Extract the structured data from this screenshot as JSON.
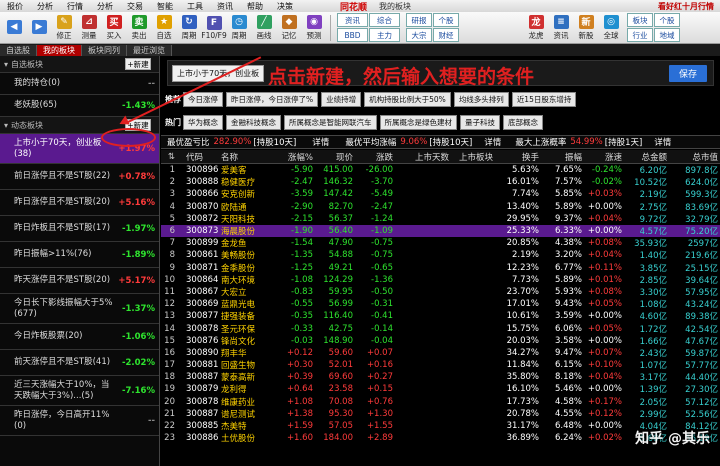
{
  "menu": {
    "items": [
      "报价",
      "分析",
      "行情",
      "分析",
      "交易",
      "智能",
      "工具",
      "资讯",
      "帮助",
      "决策"
    ],
    "brand": "同花顺",
    "board": "我的板块",
    "promo": "看好红十月行情"
  },
  "toolbar": {
    "buttons": [
      {
        "label": "",
        "icon": "back-icon",
        "color": "#3a7bd5"
      },
      {
        "label": "",
        "icon": "forward-icon",
        "color": "#3a7bd5"
      },
      {
        "label": "修正",
        "icon": "edit-icon",
        "color": "#d9a21b"
      },
      {
        "label": "测量",
        "icon": "measure-icon",
        "color": "#c03030"
      },
      {
        "label": "买入",
        "icon": "buy-icon",
        "color": "#d02020"
      },
      {
        "label": "卖出",
        "icon": "sell-icon",
        "color": "#1f9a2a"
      },
      {
        "label": "自选",
        "icon": "star-icon",
        "color": "#e0a000"
      },
      {
        "label": "周期",
        "icon": "cycle-icon",
        "color": "#3060c0"
      },
      {
        "label": "F10/F9",
        "icon": "f10-icon",
        "color": "#5050b0"
      },
      {
        "label": "周期",
        "icon": "period-icon",
        "color": "#2a8ad0"
      },
      {
        "label": "画线",
        "icon": "draw-line-icon",
        "color": "#30a060"
      },
      {
        "label": "记忆",
        "icon": "memory-icon",
        "color": "#c07020"
      },
      {
        "label": "预测",
        "icon": "forecast-icon",
        "color": "#8040c0"
      }
    ],
    "tabs1": [
      "资讯",
      "综合",
      "BBD",
      "主力"
    ],
    "tabs2": [
      "研报",
      "个股",
      "大宗",
      "财经"
    ],
    "right_buttons": [
      {
        "label": "龙虎",
        "icon": "dragon-tiger-icon",
        "color": "#d03030"
      },
      {
        "label": "资讯",
        "icon": "news-icon",
        "color": "#3070c0"
      },
      {
        "label": "新股",
        "icon": "new-stock-icon",
        "color": "#d08020"
      },
      {
        "label": "全球",
        "icon": "globe-icon",
        "color": "#2090d0"
      }
    ],
    "right_tabs": [
      "板块",
      "个股",
      "行业",
      "地域"
    ]
  },
  "tabs": [
    "自选股",
    "我的板块",
    "板块同列",
    "最近浏览"
  ],
  "active_tab_index": 1,
  "sidebar": {
    "section1": {
      "title": "自选板块",
      "new_label": "+新建"
    },
    "section1_items": [
      {
        "name": "我的持仓(0)",
        "pct": "",
        "dir": ""
      },
      {
        "name": "老妖股(65)",
        "pct": "-1.43%",
        "dir": "dn"
      }
    ],
    "section2": {
      "title": "动态板块",
      "new_label": "+新建"
    },
    "section2_items": [
      {
        "name": "上市小于70天，创业板\n(38)",
        "pct": "+1.97%",
        "dir": "up",
        "selected": true
      },
      {
        "name": "前日涨停且不是ST股(22)",
        "pct": "+0.78%",
        "dir": "up"
      },
      {
        "name": "昨日涨停且不是ST股(20)",
        "pct": "+5.16%",
        "dir": "up"
      },
      {
        "name": "昨日炸板且不是ST股(17)",
        "pct": "-1.97%",
        "dir": "dn"
      },
      {
        "name": "昨日振幅>11%(76)",
        "pct": "-1.89%",
        "dir": "dn"
      },
      {
        "name": "昨天涨停且不是ST股(20)",
        "pct": "+5.17%",
        "dir": "up"
      },
      {
        "name": "今日长下影线振幅大于5%\n(677)",
        "pct": "-1.37%",
        "dir": "dn"
      },
      {
        "name": "今日炸板股票(20)",
        "pct": "-1.06%",
        "dir": "dn"
      },
      {
        "name": "前天涨停且不是ST股(41)",
        "pct": "-2.02%",
        "dir": "dn"
      },
      {
        "name": "近三天涨幅大于10%，当\n天跌幅大于3%)...(5)",
        "pct": "-7.16%",
        "dir": "dn"
      },
      {
        "name": "昨日涨停，今日高开11%\n(0)",
        "pct": "",
        "dir": ""
      }
    ]
  },
  "condition": {
    "current": "上市小于70天，创业板",
    "annotation": "点击新建，然后输入想要的条件",
    "save_label": "保存"
  },
  "recommend": {
    "label": "推荐",
    "chips": [
      "今日涨停",
      "昨日涨停，今日涨停了%",
      "业绩持增",
      "机构持股比例大于50%",
      "均线多头排列",
      "近15日股东增持"
    ]
  },
  "hot": {
    "label": "热门",
    "chips": [
      "华为概念",
      "金融科技概念",
      "所属概念是智能网联汽车",
      "所属概念是绿色建材",
      "量子科技",
      "底部概念"
    ]
  },
  "stats": {
    "max_gain_label": "最优盈亏比",
    "max_gain_value": "282.90%",
    "max_gain_note": "[持股10天]",
    "detail1": "详情",
    "avg_label": "最优平均涨幅",
    "avg_value": "9.06%",
    "avg_note": "[持股10天]",
    "detail2": "详情",
    "max_up_label": "最大上涨概率",
    "max_up_value": "54.99%",
    "max_up_note": "[持股1天]",
    "detail3": "详情"
  },
  "table": {
    "headers": [
      "",
      "代码",
      "名称",
      "涨幅%",
      "现价",
      "涨跌",
      "上市天数",
      "上市板块",
      "换手",
      "振幅",
      "涨速",
      "总金额",
      "总市值"
    ],
    "rows": [
      [
        "1",
        "300896",
        "爱美客",
        "-5.90",
        "415.00",
        "-26.00",
        "",
        "",
        "5.63%",
        "7.65%",
        "-0.24%",
        "6.20亿",
        "897.8亿"
      ],
      [
        "2",
        "300888",
        "稳健医疗",
        "-2.47",
        "146.32",
        "-3.70",
        "",
        "",
        "16.01%",
        "7.57%",
        "-0.02%",
        "10.52亿",
        "624.0亿"
      ],
      [
        "3",
        "300866",
        "安克创新",
        "-3.59",
        "147.42",
        "-5.49",
        "",
        "",
        "7.74%",
        "5.85%",
        "+0.03%",
        "2.19亿",
        "599.3亿"
      ],
      [
        "4",
        "300870",
        "欧陆通",
        "-2.90",
        "82.70",
        "-2.47",
        "",
        "",
        "13.40%",
        "5.89%",
        "+0.00%",
        "2.75亿",
        "83.69亿"
      ],
      [
        "5",
        "300872",
        "天阳科技",
        "-2.15",
        "56.37",
        "-1.24",
        "",
        "",
        "29.95%",
        "9.37%",
        "+0.04%",
        "9.72亿",
        "32.79亿"
      ],
      [
        "6",
        "300873",
        "海晨股份",
        "-1.90",
        "56.40",
        "-1.09",
        "",
        "",
        "25.33%",
        "6.33%",
        "+0.00%",
        "4.57亿",
        "75.20亿"
      ],
      [
        "7",
        "300899",
        "金龙鱼",
        "-1.54",
        "47.90",
        "-0.75",
        "",
        "",
        "20.85%",
        "4.38%",
        "+0.08%",
        "35.93亿",
        "2597亿"
      ],
      [
        "8",
        "300861",
        "美畅股份",
        "-1.35",
        "54.88",
        "-0.75",
        "",
        "",
        "2.19%",
        "3.20%",
        "+0.04%",
        "1.40亿",
        "219.6亿"
      ],
      [
        "9",
        "300871",
        "金季股份",
        "-1.25",
        "49.21",
        "-0.65",
        "",
        "",
        "12.23%",
        "6.77%",
        "+0.11%",
        "3.85亿",
        "25.15亿"
      ],
      [
        "10",
        "300864",
        "南大环境",
        "-1.08",
        "124.29",
        "-1.36",
        "",
        "",
        "7.73%",
        "5.89%",
        "+0.01%",
        "2.85亿",
        "39.64亿"
      ],
      [
        "11",
        "300867",
        "大宏立",
        "-0.83",
        "59.95",
        "-0.50",
        "",
        "",
        "23.70%",
        "5.93%",
        "+0.08%",
        "3.30亿",
        "57.95亿"
      ],
      [
        "12",
        "300869",
        "蓝鼎光电",
        "-0.55",
        "56.99",
        "-0.31",
        "",
        "",
        "17.01%",
        "9.43%",
        "+0.05%",
        "1.08亿",
        "43.24亿"
      ],
      [
        "13",
        "300877",
        "捷强装备",
        "-0.35",
        "116.40",
        "-0.41",
        "",
        "",
        "10.61%",
        "3.59%",
        "+0.00%",
        "4.60亿",
        "89.38亿"
      ],
      [
        "14",
        "300878",
        "圣元环保",
        "-0.33",
        "42.75",
        "-0.14",
        "",
        "",
        "15.75%",
        "6.06%",
        "+0.05%",
        "1.72亿",
        "42.54亿"
      ],
      [
        "15",
        "300876",
        "锋尚文化",
        "-0.03",
        "148.90",
        "-0.04",
        "",
        "",
        "20.03%",
        "3.58%",
        "+0.00%",
        "1.66亿",
        "47.67亿"
      ],
      [
        "16",
        "300890",
        "翔丰华",
        "+0.12",
        "59.60",
        "+0.07",
        "",
        "",
        "34.27%",
        "9.47%",
        "+0.07%",
        "2.43亿",
        "59.87亿"
      ],
      [
        "17",
        "300881",
        "回盛生物",
        "+0.30",
        "52.01",
        "+0.16",
        "",
        "",
        "11.84%",
        "6.15%",
        "+0.10%",
        "1.07亿",
        "57.77亿"
      ],
      [
        "18",
        "300887",
        "蒙泰高新",
        "+0.39",
        "69.60",
        "+0.27",
        "",
        "",
        "35.80%",
        "8.18%",
        "+0.04%",
        "3.17亿",
        "44.40亿"
      ],
      [
        "19",
        "300879",
        "龙利得",
        "+0.64",
        "23.58",
        "+0.15",
        "",
        "",
        "16.10%",
        "5.46%",
        "+0.00%",
        "1.39亿",
        "27.30亿"
      ],
      [
        "20",
        "300878",
        "维康药业",
        "+1.08",
        "70.08",
        "+0.76",
        "",
        "",
        "17.73%",
        "4.58%",
        "+0.17%",
        "2.05亿",
        "57.12亿"
      ],
      [
        "21",
        "300887",
        "谱尼测试",
        "+1.38",
        "95.30",
        "+1.30",
        "",
        "",
        "20.78%",
        "4.55%",
        "+0.12%",
        "2.99亿",
        "52.56亿"
      ],
      [
        "22",
        "300885",
        "杰美特",
        "+1.59",
        "57.05",
        "+1.55",
        "",
        "",
        "31.17%",
        "6.48%",
        "+0.00%",
        "4.04亿",
        "84.12亿"
      ],
      [
        "23",
        "300886",
        "土优股份",
        "+1.60",
        "184.00",
        "+2.89",
        "",
        "",
        "36.89%",
        "6.24%",
        "+0.02%",
        "8.68亿",
        "56.19亿"
      ]
    ],
    "highlight_row": 5
  },
  "watermark": "知乎 @其乐",
  "colors": {
    "up": "#ff3b3b",
    "down": "#2ee42e",
    "selection": "#5a1a8f",
    "annotation": "#e02020",
    "active_tab": "#b00000"
  }
}
